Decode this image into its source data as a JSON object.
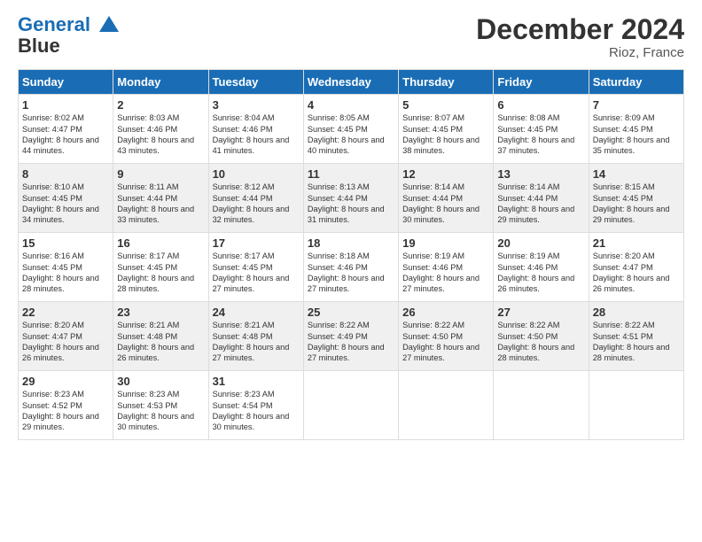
{
  "logo": {
    "line1": "General",
    "line2": "Blue"
  },
  "title": "December 2024",
  "subtitle": "Rioz, France",
  "days_header": [
    "Sunday",
    "Monday",
    "Tuesday",
    "Wednesday",
    "Thursday",
    "Friday",
    "Saturday"
  ],
  "weeks": [
    [
      {
        "day": "1",
        "sunrise": "Sunrise: 8:02 AM",
        "sunset": "Sunset: 4:47 PM",
        "daylight": "Daylight: 8 hours and 44 minutes."
      },
      {
        "day": "2",
        "sunrise": "Sunrise: 8:03 AM",
        "sunset": "Sunset: 4:46 PM",
        "daylight": "Daylight: 8 hours and 43 minutes."
      },
      {
        "day": "3",
        "sunrise": "Sunrise: 8:04 AM",
        "sunset": "Sunset: 4:46 PM",
        "daylight": "Daylight: 8 hours and 41 minutes."
      },
      {
        "day": "4",
        "sunrise": "Sunrise: 8:05 AM",
        "sunset": "Sunset: 4:45 PM",
        "daylight": "Daylight: 8 hours and 40 minutes."
      },
      {
        "day": "5",
        "sunrise": "Sunrise: 8:07 AM",
        "sunset": "Sunset: 4:45 PM",
        "daylight": "Daylight: 8 hours and 38 minutes."
      },
      {
        "day": "6",
        "sunrise": "Sunrise: 8:08 AM",
        "sunset": "Sunset: 4:45 PM",
        "daylight": "Daylight: 8 hours and 37 minutes."
      },
      {
        "day": "7",
        "sunrise": "Sunrise: 8:09 AM",
        "sunset": "Sunset: 4:45 PM",
        "daylight": "Daylight: 8 hours and 35 minutes."
      }
    ],
    [
      {
        "day": "8",
        "sunrise": "Sunrise: 8:10 AM",
        "sunset": "Sunset: 4:45 PM",
        "daylight": "Daylight: 8 hours and 34 minutes."
      },
      {
        "day": "9",
        "sunrise": "Sunrise: 8:11 AM",
        "sunset": "Sunset: 4:44 PM",
        "daylight": "Daylight: 8 hours and 33 minutes."
      },
      {
        "day": "10",
        "sunrise": "Sunrise: 8:12 AM",
        "sunset": "Sunset: 4:44 PM",
        "daylight": "Daylight: 8 hours and 32 minutes."
      },
      {
        "day": "11",
        "sunrise": "Sunrise: 8:13 AM",
        "sunset": "Sunset: 4:44 PM",
        "daylight": "Daylight: 8 hours and 31 minutes."
      },
      {
        "day": "12",
        "sunrise": "Sunrise: 8:14 AM",
        "sunset": "Sunset: 4:44 PM",
        "daylight": "Daylight: 8 hours and 30 minutes."
      },
      {
        "day": "13",
        "sunrise": "Sunrise: 8:14 AM",
        "sunset": "Sunset: 4:44 PM",
        "daylight": "Daylight: 8 hours and 29 minutes."
      },
      {
        "day": "14",
        "sunrise": "Sunrise: 8:15 AM",
        "sunset": "Sunset: 4:45 PM",
        "daylight": "Daylight: 8 hours and 29 minutes."
      }
    ],
    [
      {
        "day": "15",
        "sunrise": "Sunrise: 8:16 AM",
        "sunset": "Sunset: 4:45 PM",
        "daylight": "Daylight: 8 hours and 28 minutes."
      },
      {
        "day": "16",
        "sunrise": "Sunrise: 8:17 AM",
        "sunset": "Sunset: 4:45 PM",
        "daylight": "Daylight: 8 hours and 28 minutes."
      },
      {
        "day": "17",
        "sunrise": "Sunrise: 8:17 AM",
        "sunset": "Sunset: 4:45 PM",
        "daylight": "Daylight: 8 hours and 27 minutes."
      },
      {
        "day": "18",
        "sunrise": "Sunrise: 8:18 AM",
        "sunset": "Sunset: 4:46 PM",
        "daylight": "Daylight: 8 hours and 27 minutes."
      },
      {
        "day": "19",
        "sunrise": "Sunrise: 8:19 AM",
        "sunset": "Sunset: 4:46 PM",
        "daylight": "Daylight: 8 hours and 27 minutes."
      },
      {
        "day": "20",
        "sunrise": "Sunrise: 8:19 AM",
        "sunset": "Sunset: 4:46 PM",
        "daylight": "Daylight: 8 hours and 26 minutes."
      },
      {
        "day": "21",
        "sunrise": "Sunrise: 8:20 AM",
        "sunset": "Sunset: 4:47 PM",
        "daylight": "Daylight: 8 hours and 26 minutes."
      }
    ],
    [
      {
        "day": "22",
        "sunrise": "Sunrise: 8:20 AM",
        "sunset": "Sunset: 4:47 PM",
        "daylight": "Daylight: 8 hours and 26 minutes."
      },
      {
        "day": "23",
        "sunrise": "Sunrise: 8:21 AM",
        "sunset": "Sunset: 4:48 PM",
        "daylight": "Daylight: 8 hours and 26 minutes."
      },
      {
        "day": "24",
        "sunrise": "Sunrise: 8:21 AM",
        "sunset": "Sunset: 4:48 PM",
        "daylight": "Daylight: 8 hours and 27 minutes."
      },
      {
        "day": "25",
        "sunrise": "Sunrise: 8:22 AM",
        "sunset": "Sunset: 4:49 PM",
        "daylight": "Daylight: 8 hours and 27 minutes."
      },
      {
        "day": "26",
        "sunrise": "Sunrise: 8:22 AM",
        "sunset": "Sunset: 4:50 PM",
        "daylight": "Daylight: 8 hours and 27 minutes."
      },
      {
        "day": "27",
        "sunrise": "Sunrise: 8:22 AM",
        "sunset": "Sunset: 4:50 PM",
        "daylight": "Daylight: 8 hours and 28 minutes."
      },
      {
        "day": "28",
        "sunrise": "Sunrise: 8:22 AM",
        "sunset": "Sunset: 4:51 PM",
        "daylight": "Daylight: 8 hours and 28 minutes."
      }
    ],
    [
      {
        "day": "29",
        "sunrise": "Sunrise: 8:23 AM",
        "sunset": "Sunset: 4:52 PM",
        "daylight": "Daylight: 8 hours and 29 minutes."
      },
      {
        "day": "30",
        "sunrise": "Sunrise: 8:23 AM",
        "sunset": "Sunset: 4:53 PM",
        "daylight": "Daylight: 8 hours and 30 minutes."
      },
      {
        "day": "31",
        "sunrise": "Sunrise: 8:23 AM",
        "sunset": "Sunset: 4:54 PM",
        "daylight": "Daylight: 8 hours and 30 minutes."
      },
      {
        "day": "",
        "sunrise": "",
        "sunset": "",
        "daylight": ""
      },
      {
        "day": "",
        "sunrise": "",
        "sunset": "",
        "daylight": ""
      },
      {
        "day": "",
        "sunrise": "",
        "sunset": "",
        "daylight": ""
      },
      {
        "day": "",
        "sunrise": "",
        "sunset": "",
        "daylight": ""
      }
    ]
  ]
}
